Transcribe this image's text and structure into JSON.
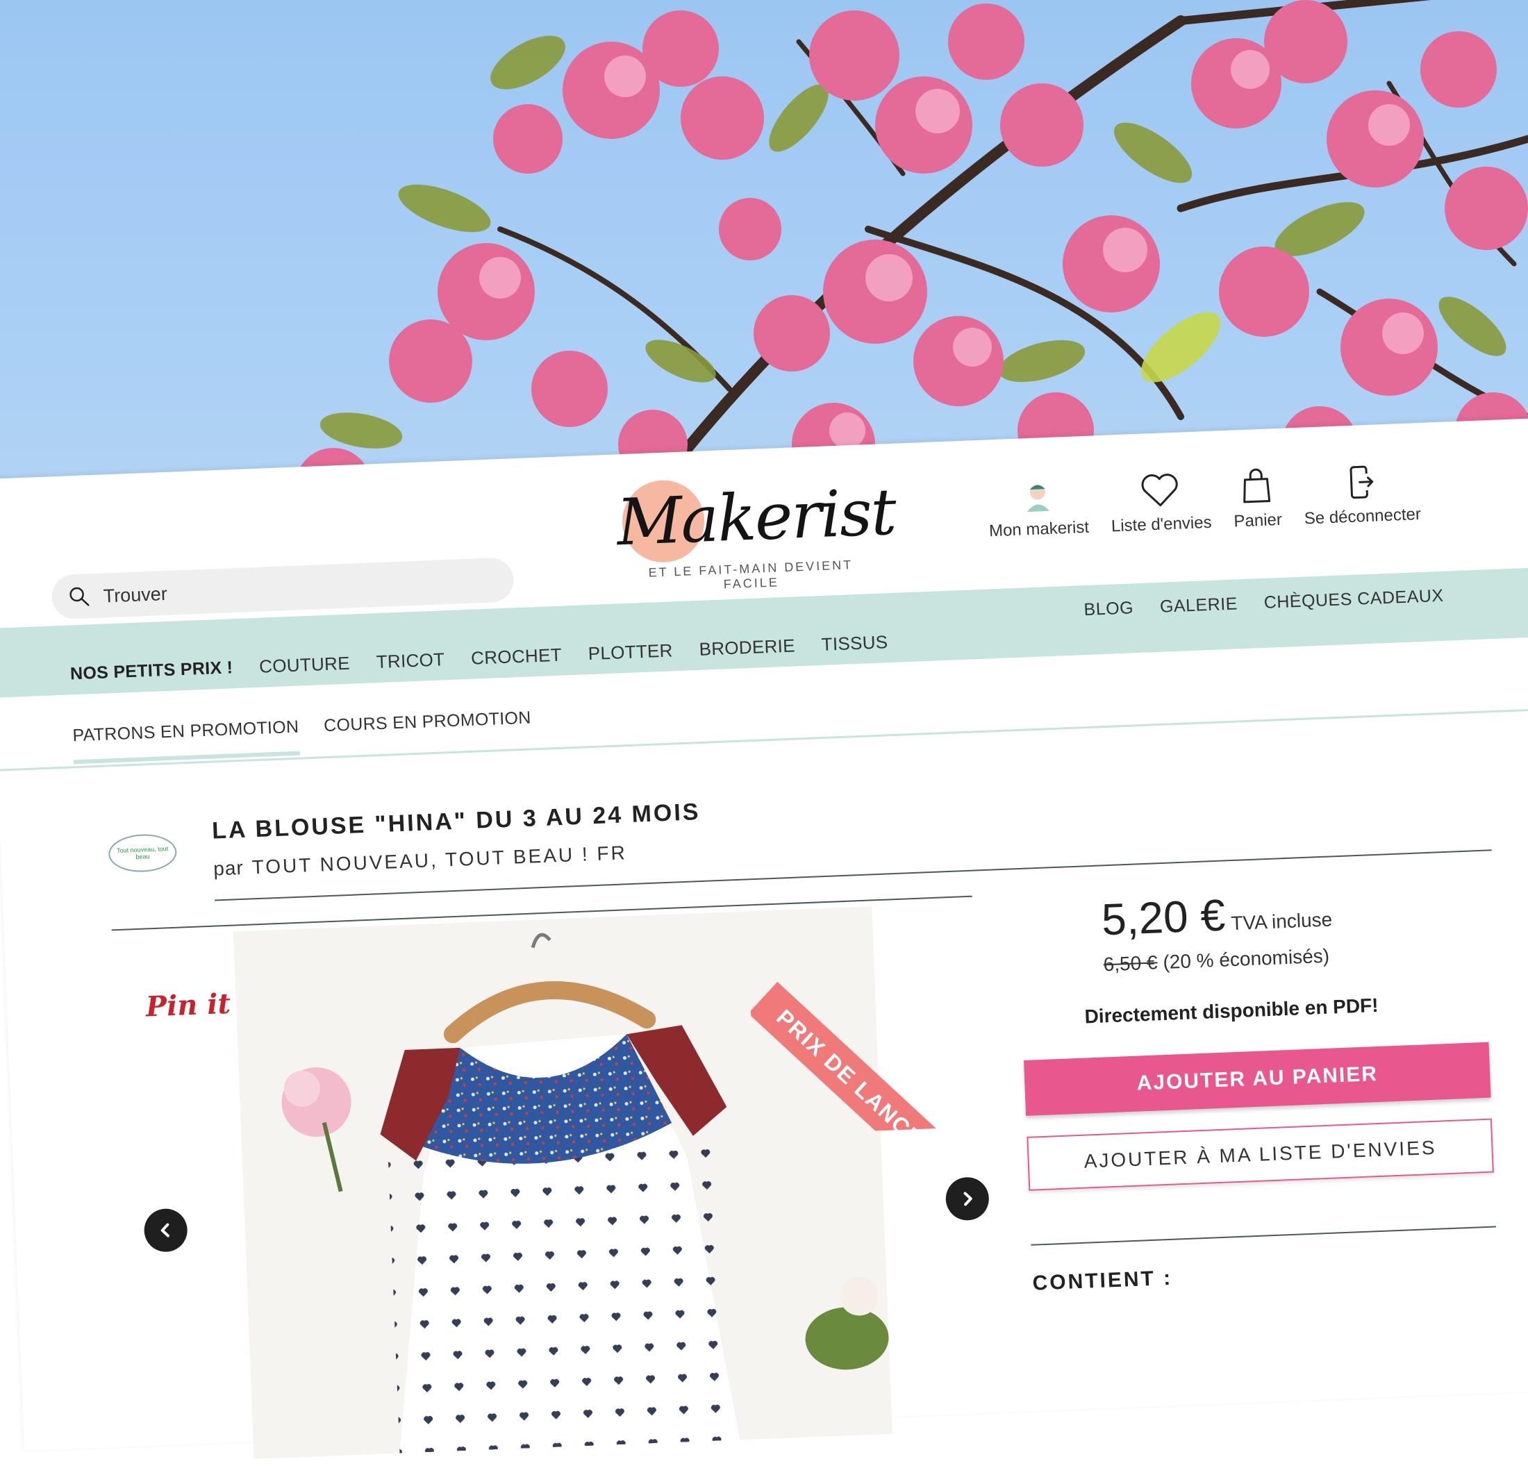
{
  "header": {
    "logo_text": "Makerist",
    "tagline": "ET LE FAIT-MAIN DEVIENT FACILE",
    "search": {
      "placeholder": "Trouver"
    },
    "user_menu": [
      {
        "label": "Mon makerist",
        "icon": "avatar-icon"
      },
      {
        "label": "Liste d'envies",
        "icon": "heart-icon"
      },
      {
        "label": "Panier",
        "icon": "shopping-bag-icon"
      },
      {
        "label": "Se déconnecter",
        "icon": "logout-icon"
      }
    ]
  },
  "nav": {
    "main": [
      "NOS PETITS PRIX !",
      "COUTURE",
      "TRICOT",
      "CROCHET",
      "PLOTTER",
      "BRODERIE",
      "TISSUS"
    ],
    "right": [
      "BLOG",
      "GALERIE",
      "CHÈQUES CADEAUX"
    ]
  },
  "subnav": {
    "items": [
      "PATRONS EN PROMOTION",
      "COURS EN PROMOTION"
    ],
    "active": "PATRONS EN PROMOTION"
  },
  "product": {
    "title": "LA BLOUSE \"HINA\" DU 3 AU 24 MOIS",
    "by_prefix": "par",
    "shop_name": "TOUT NOUVEAU, TOUT BEAU ! FR",
    "shop_logo_text": "Tout nouveau, tout beau",
    "pin_label": "Pin it",
    "ribbon": "PRIX DE LANCEMENT",
    "price": "5,20 €",
    "price_suffix": "TVA incluse",
    "old_price": "6,50 €",
    "savings": "(20 % économisés)",
    "pdf_note": "Directement disponible en PDF!",
    "add_to_cart": "AJOUTER AU PANIER",
    "add_to_wishlist": "AJOUTER À MA LISTE D'ENVIES",
    "contains_heading": "CONTIENT :"
  },
  "colors": {
    "accent_pink": "#e8578e",
    "nav_band": "#c8e4df",
    "ribbon": "#f07a79",
    "logo_circle": "#f6b8a0"
  }
}
